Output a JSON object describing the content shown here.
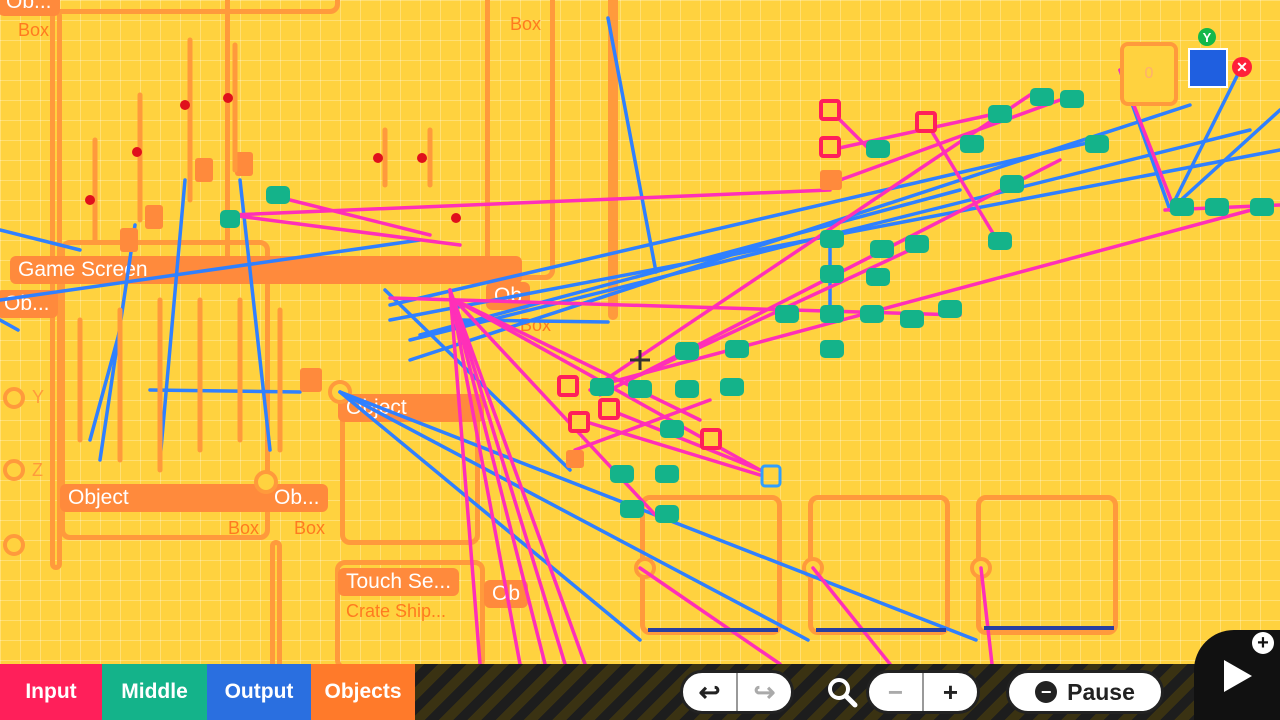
{
  "nodes": {
    "game_screen": "Game Screen",
    "object_1": "Object",
    "object_2": "Object",
    "ob_1": "Ob...",
    "ob_top": "Ob...",
    "ob_left": "Ob...",
    "ob_right": "Ob",
    "ob_bottom": "Ob",
    "touch_sensor": "Touch Se...",
    "touch_sub": "Crate Ship...",
    "box_1": "Box",
    "box_2": "Box",
    "box_3": "Box",
    "box_4": "Box",
    "box_5": "Box",
    "axis_y": "Y",
    "axis_z": "Z",
    "texture_value": "0",
    "y_badge": "Y"
  },
  "colors": {
    "background": "#ffd23f",
    "input_tab": "#ff1f5a",
    "middle_tab": "#14b38a",
    "output_tab": "#2a6fe0",
    "objects_tab": "#ff7a2a",
    "wire_pink": "#ff2fb8",
    "wire_blue": "#2f80ff"
  },
  "tabs": {
    "input": "Input",
    "middle": "Middle",
    "output": "Output",
    "objects": "Objects"
  },
  "toolbar": {
    "undo_icon": "undo-icon",
    "redo_icon": "redo-icon",
    "zoom_icon": "magnifier-icon",
    "zoom_out": "−",
    "zoom_in": "+",
    "pause_label": "Pause",
    "minus_badge": "−",
    "add_badge": "+"
  }
}
